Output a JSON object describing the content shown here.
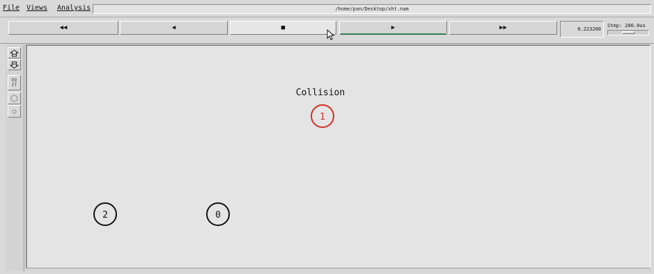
{
  "menubar": {
    "file": "File",
    "views": "Views",
    "analysis": "Analysis",
    "filepath": "/home/pan/Desktop/sht.nam"
  },
  "controls": {
    "rewind_icon": "rewind-icon",
    "rewind_glyph": "◀◀",
    "back_icon": "step-back-icon",
    "back_glyph": "◀",
    "stop_icon": "stop-icon",
    "stop_glyph": "■",
    "play_icon": "play-icon",
    "play_glyph": "▶",
    "forward_icon": "fast-forward-icon",
    "forward_glyph": "▶▶",
    "time": "0.223200",
    "step": "Step: 200.0us"
  },
  "toolbar": {
    "edit_label": "EDIT"
  },
  "canvas": {
    "annotation": "Collision",
    "nodes": [
      {
        "id": "1",
        "color": "#d22f24"
      },
      {
        "id": "2",
        "color": "#111111"
      },
      {
        "id": "0",
        "color": "#111111"
      }
    ]
  },
  "colors": {
    "play_progress": "#2f7d4f",
    "collision_node": "#d22f24",
    "normal_node": "#111111"
  }
}
